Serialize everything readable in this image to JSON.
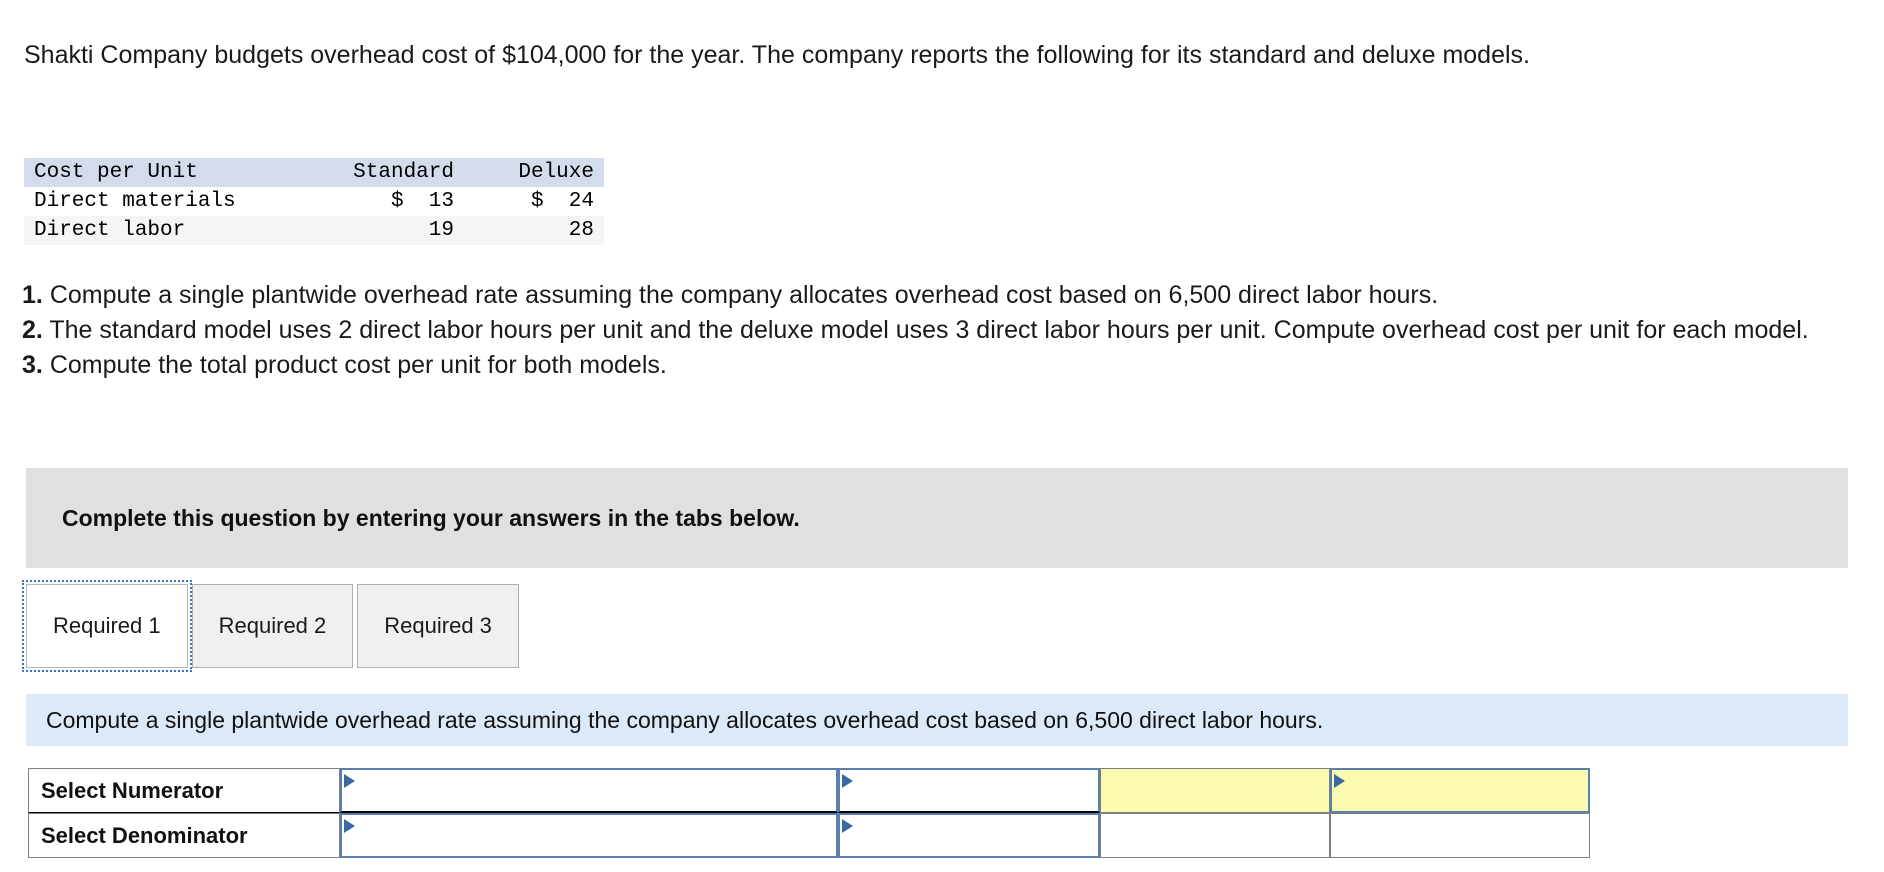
{
  "problem": {
    "intro": "Shakti Company budgets overhead cost of $104,000 for the year. The company reports the following for its standard and deluxe models.",
    "table": {
      "headers": [
        "Cost per Unit",
        "Standard",
        "Deluxe"
      ],
      "rows": [
        {
          "label": "Direct materials",
          "standard": "$  13",
          "deluxe": "$  24"
        },
        {
          "label": "Direct labor",
          "standard": "19",
          "deluxe": "28"
        }
      ]
    },
    "requirements": [
      {
        "num": "1.",
        "text": "Compute a single plantwide overhead rate assuming the company allocates overhead cost based on 6,500 direct labor hours."
      },
      {
        "num": "2.",
        "text": "The standard model uses 2 direct labor hours per unit and the deluxe model uses 3 direct labor hours per unit. Compute overhead cost per unit for each model."
      },
      {
        "num": "3.",
        "text": "Compute the total product cost per unit for both models."
      }
    ]
  },
  "banner": {
    "text": "Complete this question by entering your answers in the tabs below."
  },
  "tabs": [
    {
      "label": "Required 1",
      "active": true
    },
    {
      "label": "Required 2",
      "active": false
    },
    {
      "label": "Required 3",
      "active": false
    }
  ],
  "instruction": {
    "text": "Compute a single plantwide overhead rate assuming the company allocates overhead cost based on 6,500 direct labor hours."
  },
  "answer_form": {
    "rows": [
      {
        "label": "Select Numerator",
        "cells": [
          {
            "type": "input",
            "value": "",
            "highlight": false
          },
          {
            "type": "input",
            "value": "",
            "highlight": false
          },
          {
            "type": "plain",
            "value": "",
            "highlight": true
          },
          {
            "type": "input",
            "value": "",
            "highlight": true
          }
        ]
      },
      {
        "label": "Select Denominator",
        "cells": [
          {
            "type": "input",
            "value": "",
            "highlight": false
          },
          {
            "type": "input",
            "value": "",
            "highlight": false
          },
          {
            "type": "plain",
            "value": "",
            "highlight": false
          },
          {
            "type": "plain",
            "value": "",
            "highlight": false
          }
        ]
      }
    ]
  },
  "colors": {
    "banner_gray": "#e0e0e0",
    "instruction_blue": "#dce9f7",
    "table_header_blue": "#d4dceb",
    "input_border_blue": "#5b7fad",
    "highlight_yellow": "#fbfbb0",
    "marker_blue": "#3a6ba5"
  }
}
